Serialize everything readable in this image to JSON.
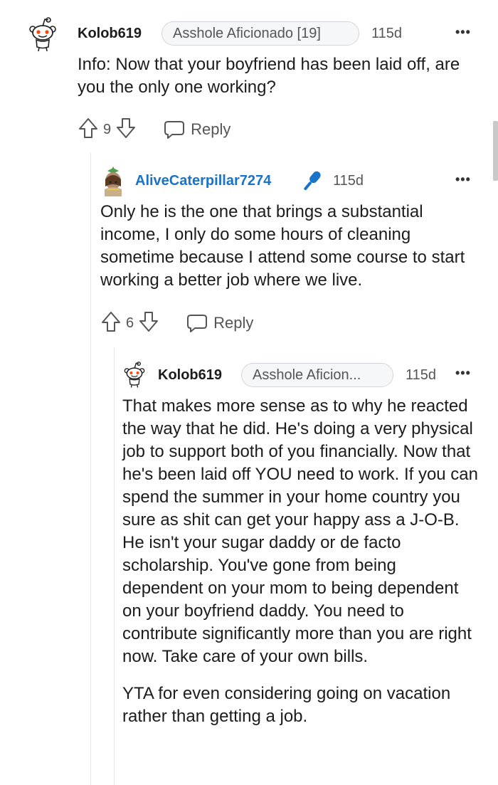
{
  "comments": [
    {
      "username": "Kolob619",
      "flair": "Asshole Aficionado [19]",
      "time": "115d",
      "more": "•••",
      "paragraphs": [
        "Info: Now that your boyfriend has been laid off, are you the only one working?"
      ],
      "votes": "9",
      "reply_label": "Reply"
    },
    {
      "username": "AliveCaterpillar7274",
      "time": "115d",
      "more": "•••",
      "paragraphs": [
        "Only he is the one that brings a substantial income, I only do some hours of cleaning sometime because I attend some course to start working a better job where we live."
      ],
      "votes": "6",
      "reply_label": "Reply"
    },
    {
      "username": "Kolob619",
      "flair": "Asshole Aficion...",
      "time": "115d",
      "more": "•••",
      "paragraphs": [
        "That makes more sense as to why he reacted the way that he did. He's doing a very physical job to support both of you financially. Now that he's been laid off YOU need to work. If you can spend the summer in your home country you sure as shit can get your happy ass a J-O-B. He isn't your sugar daddy or de facto scholarship. You've gone from being dependent on your mom to being dependent on your boyfriend daddy. You need to contribute significantly more than you are right now. Take care of your own bills.",
        "YTA for even considering going on vacation rather than getting a job."
      ]
    }
  ],
  "icons": {
    "snoo": "reddit-snoo-avatar",
    "custom": "custom-avatar",
    "mod": "microphone-icon",
    "upvote": "upvote-arrow-icon",
    "downvote": "downvote-arrow-icon",
    "reply": "speech-bubble-icon"
  },
  "colors": {
    "username_op": "#1a73c8",
    "mic": "#1a73c8",
    "thread_line": "#e4e6e8"
  }
}
